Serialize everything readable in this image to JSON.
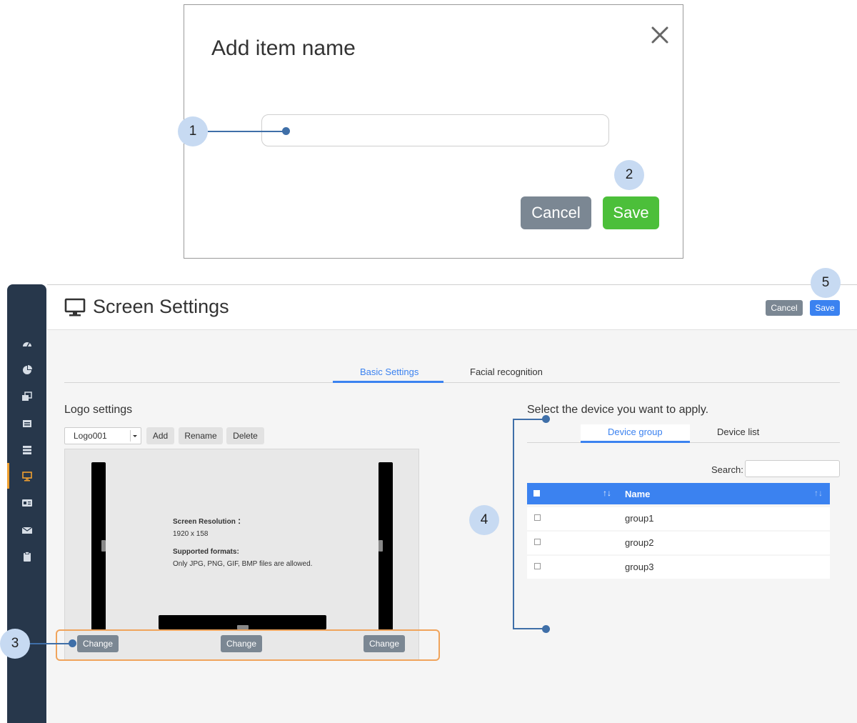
{
  "dialog": {
    "title": "Add item name",
    "input_value": "",
    "cancel_label": "Cancel",
    "save_label": "Save"
  },
  "callouts": [
    "1",
    "2",
    "3",
    "4",
    "5"
  ],
  "header": {
    "title": "Screen Settings",
    "cancel_label": "Cancel",
    "save_label": "Save"
  },
  "sidebar": {
    "items": [
      {
        "icon": "dashboard-icon"
      },
      {
        "icon": "pie-chart-icon"
      },
      {
        "icon": "media-icon"
      },
      {
        "icon": "list-icon"
      },
      {
        "icon": "stack-icon"
      },
      {
        "icon": "monitor-icon",
        "active": true
      },
      {
        "icon": "id-card-icon"
      },
      {
        "icon": "envelope-icon"
      },
      {
        "icon": "clipboard-icon"
      }
    ]
  },
  "tabs": [
    "Basic Settings",
    "Facial recognition"
  ],
  "logo": {
    "section_title": "Logo settings",
    "selected": "Logo001",
    "add_label": "Add",
    "rename_label": "Rename",
    "delete_label": "Delete",
    "resolution_label": "Screen Resolution ：",
    "resolution_value": "1920 x 158",
    "formats_label": "Supported formats:",
    "formats_value": "Only JPG, PNG, GIF, BMP files are allowed.",
    "change_labels": [
      "Change",
      "Change",
      "Change"
    ]
  },
  "devices": {
    "section_title": "Select the device you want to apply.",
    "tabs": [
      "Device group",
      "Device list"
    ],
    "search_label": "Search:",
    "search_value": "",
    "table": {
      "sort_symbol": "↑↓",
      "column": "Name",
      "rows": [
        "group1",
        "group2",
        "group3"
      ]
    }
  },
  "colors": {
    "accent": "#3b82f0",
    "save_green": "#4cbf3a",
    "gray_button": "#7b8793",
    "sidebar": "#27374b",
    "callout": "#c7daf2",
    "highlight": "#f0a45c"
  }
}
